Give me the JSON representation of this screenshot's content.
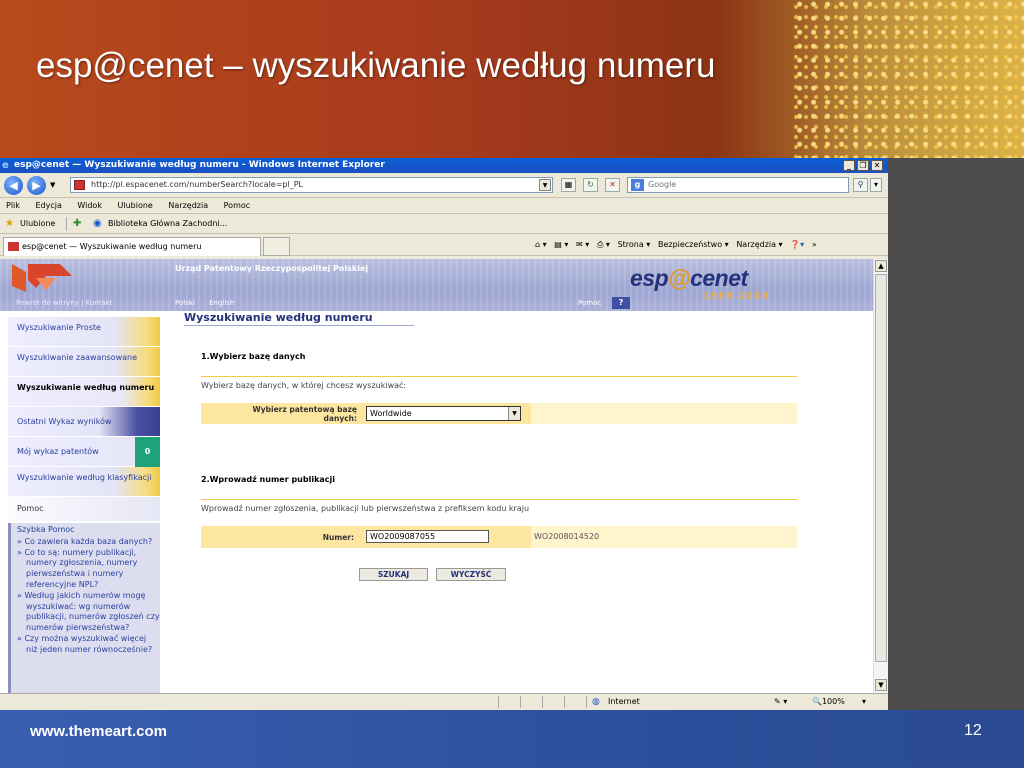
{
  "slide": {
    "title": "esp@cenet – wyszukiwanie według numeru",
    "footer_url": "www.themeart.com",
    "page_number": "12"
  },
  "browser": {
    "window_title": "esp@cenet — Wyszukiwanie według numeru - Windows Internet Explorer",
    "url": "http://pl.espacenet.com/numberSearch?locale=pl_PL",
    "search_placeholder": "Google",
    "menu": [
      "Plik",
      "Edycja",
      "Widok",
      "Ulubione",
      "Narzędzia",
      "Pomoc"
    ],
    "favorites_label": "Ulubione",
    "favorite_link": "Biblioteka Główna Zachodni...",
    "tab_title": "esp@cenet — Wyszukiwanie według numeru",
    "command_bar": {
      "strona": "Strona",
      "bezpieczenstwo": "Bezpieczeństwo",
      "narzedzia": "Narzędzia"
    },
    "status": {
      "zone": "Internet",
      "zoom": "100%"
    }
  },
  "page": {
    "org_name": "Urząd Patentowy Rzeczypospolitej Polskiej",
    "nav_left": "Powrót do witryny | Kontakt",
    "languages": [
      "Polski",
      "English"
    ],
    "help_link": "Pomoc",
    "help_icon_text": "?",
    "brand": {
      "name_pre": "esp",
      "name_at": "@",
      "name_post": "cenet",
      "years": "1998-2008"
    },
    "sidebar": [
      {
        "label": "Wyszukiwanie Proste"
      },
      {
        "label": "Wyszukiwanie zaawansowane"
      },
      {
        "label": "Wyszukiwanie według numeru"
      },
      {
        "label": "Ostatni Wykaz wyników"
      },
      {
        "label": "Mój wykaz patentów",
        "badge": "0"
      },
      {
        "label": "Wyszukiwanie według klasyfikacji"
      },
      {
        "label": "Pomoc"
      }
    ],
    "quick_help": {
      "title": "Szybka Pomoc",
      "items": [
        "Co zawiera każda baza danych?",
        "Co to są: numery publikacji, numery zgłoszenia, numery pierwszeństwa i numery referencyjne NPL?",
        "Według jakich numerów mogę wyszukiwać: wg numerów publikacji, numerów zgłoszeń czy numerów pierwszeństwa?",
        "Czy można wyszukiwać więcej niż jeden numer równocześnie?"
      ]
    },
    "main_title": "Wyszukiwanie według numeru",
    "section1": {
      "title": "1.Wybierz bazę danych",
      "description": "Wybierz bazę danych, w której chcesz wyszukiwać:",
      "field_label": "Wybierz patentową bazę danych:",
      "selected": "Worldwide"
    },
    "section2": {
      "title": "2.Wprowadź numer publikacji",
      "description": "Wprowadź numer zgłoszenia, publikacji lub pierwszeństwa z prefiksem kodu kraju",
      "field_label": "Numer:",
      "value": "WO2009087055",
      "example": "WO2008014520"
    },
    "buttons": {
      "search": "SZUKAJ",
      "clear": "WYCZYŚĆ"
    }
  }
}
